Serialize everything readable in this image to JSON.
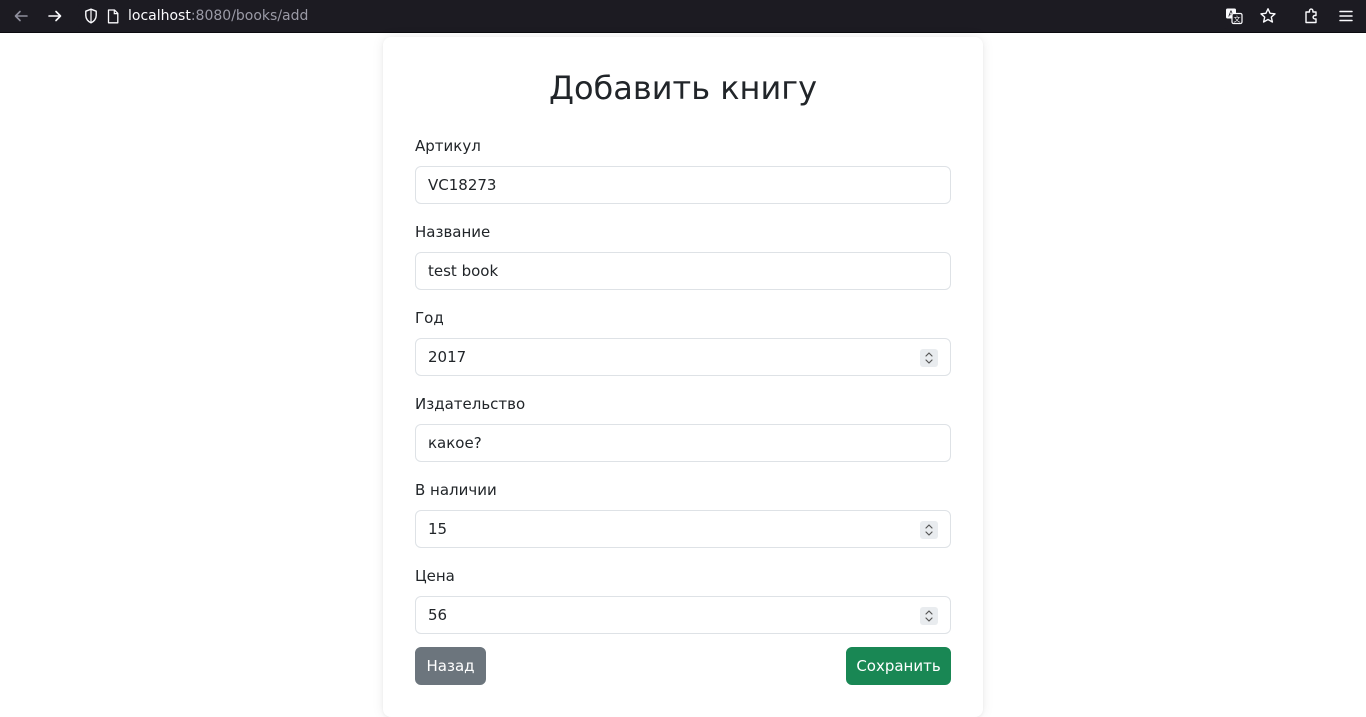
{
  "browser": {
    "url_host": "localhost",
    "url_rest": ":8080/books/add",
    "icons": {
      "back": "arrow-left-icon",
      "forward": "arrow-right-icon",
      "shield": "shield-icon",
      "page": "page-icon",
      "translate": "translate-icon",
      "bookmark": "star-icon",
      "extensions": "puzzle-icon",
      "menu": "hamburger-menu-icon"
    }
  },
  "form": {
    "title": "Добавить книгу",
    "fields": [
      {
        "label": "Артикул",
        "value": "VC18273",
        "type": "text"
      },
      {
        "label": "Название",
        "value": "test book",
        "type": "text"
      },
      {
        "label": "Год",
        "value": "2017",
        "type": "number"
      },
      {
        "label": "Издательство",
        "value": "какое?",
        "type": "text"
      },
      {
        "label": "В наличии",
        "value": "15",
        "type": "number"
      },
      {
        "label": "Цена",
        "value": "56",
        "type": "number"
      }
    ],
    "back_label": "Назад",
    "save_label": "Сохранить"
  },
  "colors": {
    "back_button": "#6c757d",
    "save_button": "#198754",
    "chrome": "#1c1b22"
  }
}
